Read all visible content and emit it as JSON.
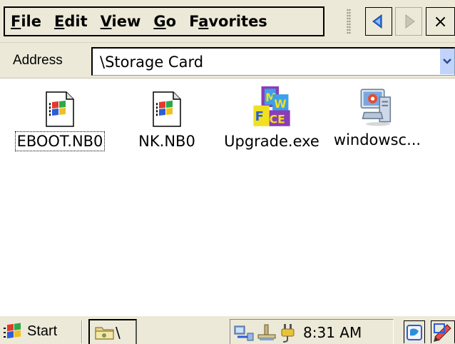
{
  "menubar": {
    "items": [
      {
        "key": "F",
        "rest": "ile"
      },
      {
        "key": "E",
        "rest": "dit"
      },
      {
        "key": "V",
        "rest": "iew"
      },
      {
        "key": "G",
        "rest": "o"
      },
      {
        "pre": "F",
        "key": "a",
        "rest": "vorites"
      }
    ],
    "close_label": "×"
  },
  "address": {
    "label": "Address",
    "value": "\\Storage Card"
  },
  "files": [
    {
      "name": "EBOOT.NB0",
      "icon": "windows-file-icon",
      "selected": true
    },
    {
      "name": "NK.NB0",
      "icon": "windows-file-icon",
      "selected": false
    },
    {
      "name": "Upgrade.exe",
      "icon": "mwfcce-app-icon",
      "selected": false
    },
    {
      "name": "windowsc...",
      "icon": "computer-globe-icon",
      "selected": false
    }
  ],
  "taskbar": {
    "start_label": "Start",
    "task_label": "\\",
    "time": "8:31 AM"
  },
  "colors": {
    "chrome": "#ece9d8",
    "nav_arrow": "#2a6fd6",
    "dropdown": "#c1d3fb"
  }
}
